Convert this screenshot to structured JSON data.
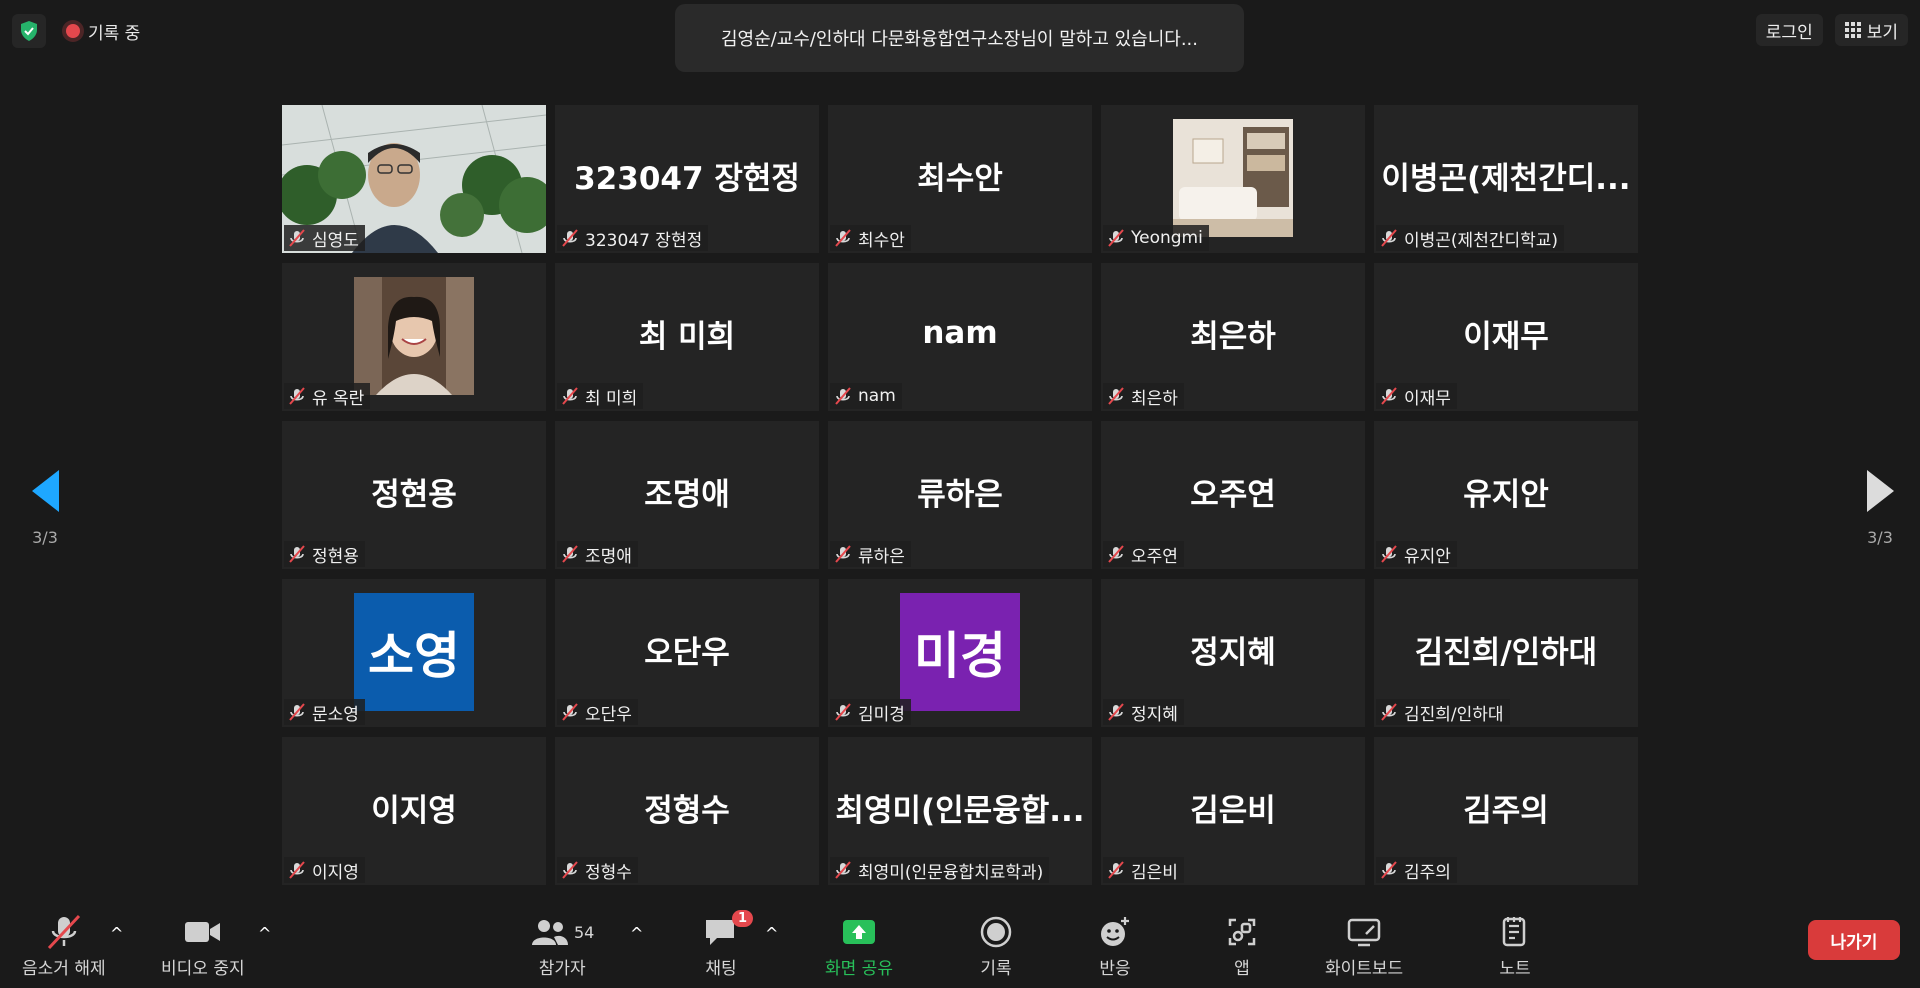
{
  "top_bar": {
    "recording_label": "기록 중",
    "speaker_banner": "김영순/교수/인하대 다문화융합연구소장님이 말하고 있습니다...",
    "login_label": "로그인",
    "view_label": "보기"
  },
  "pager": {
    "left": "3/3",
    "right": "3/3"
  },
  "participants": [
    {
      "tile": "",
      "name": "심영도",
      "type": "video"
    },
    {
      "tile": "323047 장현정",
      "name": "323047 장현정"
    },
    {
      "tile": "최수안",
      "name": "최수안"
    },
    {
      "tile": "",
      "name": "Yeongmi",
      "type": "photo-room"
    },
    {
      "tile": "이병곤(제천간디...",
      "name": "이병곤(제천간디학교)"
    },
    {
      "tile": "",
      "name": "유 옥란",
      "type": "photo-woman"
    },
    {
      "tile": "최 미희",
      "name": "최 미희"
    },
    {
      "tile": "nam",
      "name": "nam"
    },
    {
      "tile": "최은하",
      "name": "최은하"
    },
    {
      "tile": "이재무",
      "name": "이재무"
    },
    {
      "tile": "정현용",
      "name": "정현용"
    },
    {
      "tile": "조명애",
      "name": "조명애"
    },
    {
      "tile": "류하은",
      "name": "류하은"
    },
    {
      "tile": "오주연",
      "name": "오주연"
    },
    {
      "tile": "유지안",
      "name": "유지안"
    },
    {
      "tile": "소영",
      "name": "문소영",
      "type": "avatar",
      "color": "#0b5cad"
    },
    {
      "tile": "오단우",
      "name": "오단우"
    },
    {
      "tile": "미경",
      "name": "김미경",
      "type": "avatar",
      "color": "#7a22b0"
    },
    {
      "tile": "정지혜",
      "name": "정지혜"
    },
    {
      "tile": "김진희/인하대",
      "name": "김진희/인하대"
    },
    {
      "tile": "이지영",
      "name": "이지영"
    },
    {
      "tile": "정형수",
      "name": "정형수"
    },
    {
      "tile": "최영미(인문융합...",
      "name": "최영미(인문융합치료학과)"
    },
    {
      "tile": "김은비",
      "name": "김은비"
    },
    {
      "tile": "김주의",
      "name": "김주의"
    }
  ],
  "toolbar": {
    "unmute": "음소거 해제",
    "stop_video": "비디오 중지",
    "participants": "참가자",
    "participant_count": "54",
    "chat": "채팅",
    "chat_badge": "1",
    "share": "화면 공유",
    "record": "기록",
    "reactions": "반응",
    "apps": "앱",
    "whiteboard": "화이트보드",
    "notes": "노트",
    "leave": "나가기"
  },
  "colors": {
    "accent_blue": "#1ea7ff",
    "share_green": "#28c05a",
    "leave_red": "#d93b3b",
    "record_red": "#e5484d"
  }
}
